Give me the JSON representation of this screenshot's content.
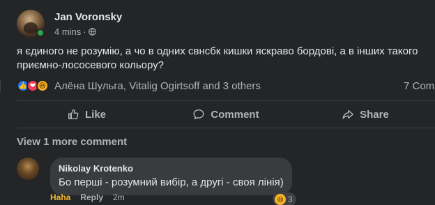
{
  "post": {
    "author": "Jan Voronsky",
    "time": "4 mins",
    "privacy_icon": "globe-icon",
    "text": "я єдиного не розумію, а чо в одних свнсбк кишки яскраво бордові, а в інших такого приємно-лососевого кольору?"
  },
  "reactions": {
    "icons": [
      "like-icon",
      "love-icon",
      "haha-icon"
    ],
    "names": "Алёна Шульга, Vitalig Ogirtsoff and 3 others",
    "comments_count": "7 Comm"
  },
  "actions": {
    "like": "Like",
    "comment": "Comment",
    "share": "Share"
  },
  "view_more": "View 1 more comment",
  "comment": {
    "author": "Nikolay Krotenko",
    "text": "Бо перші - розумний вибір, а другі - своя лінія)",
    "reaction_count": "3",
    "haha_label": "Haha",
    "reply_label": "Reply",
    "time": "2m"
  },
  "colors": {
    "background": "#242526",
    "bubble": "#3a3b3c",
    "text_primary": "#e4e6eb",
    "text_secondary": "#b0b3b8",
    "like_blue": "#2078f4",
    "love_red": "#f33e58",
    "haha_yellow": "#f7b125",
    "online_green": "#31a24c"
  }
}
